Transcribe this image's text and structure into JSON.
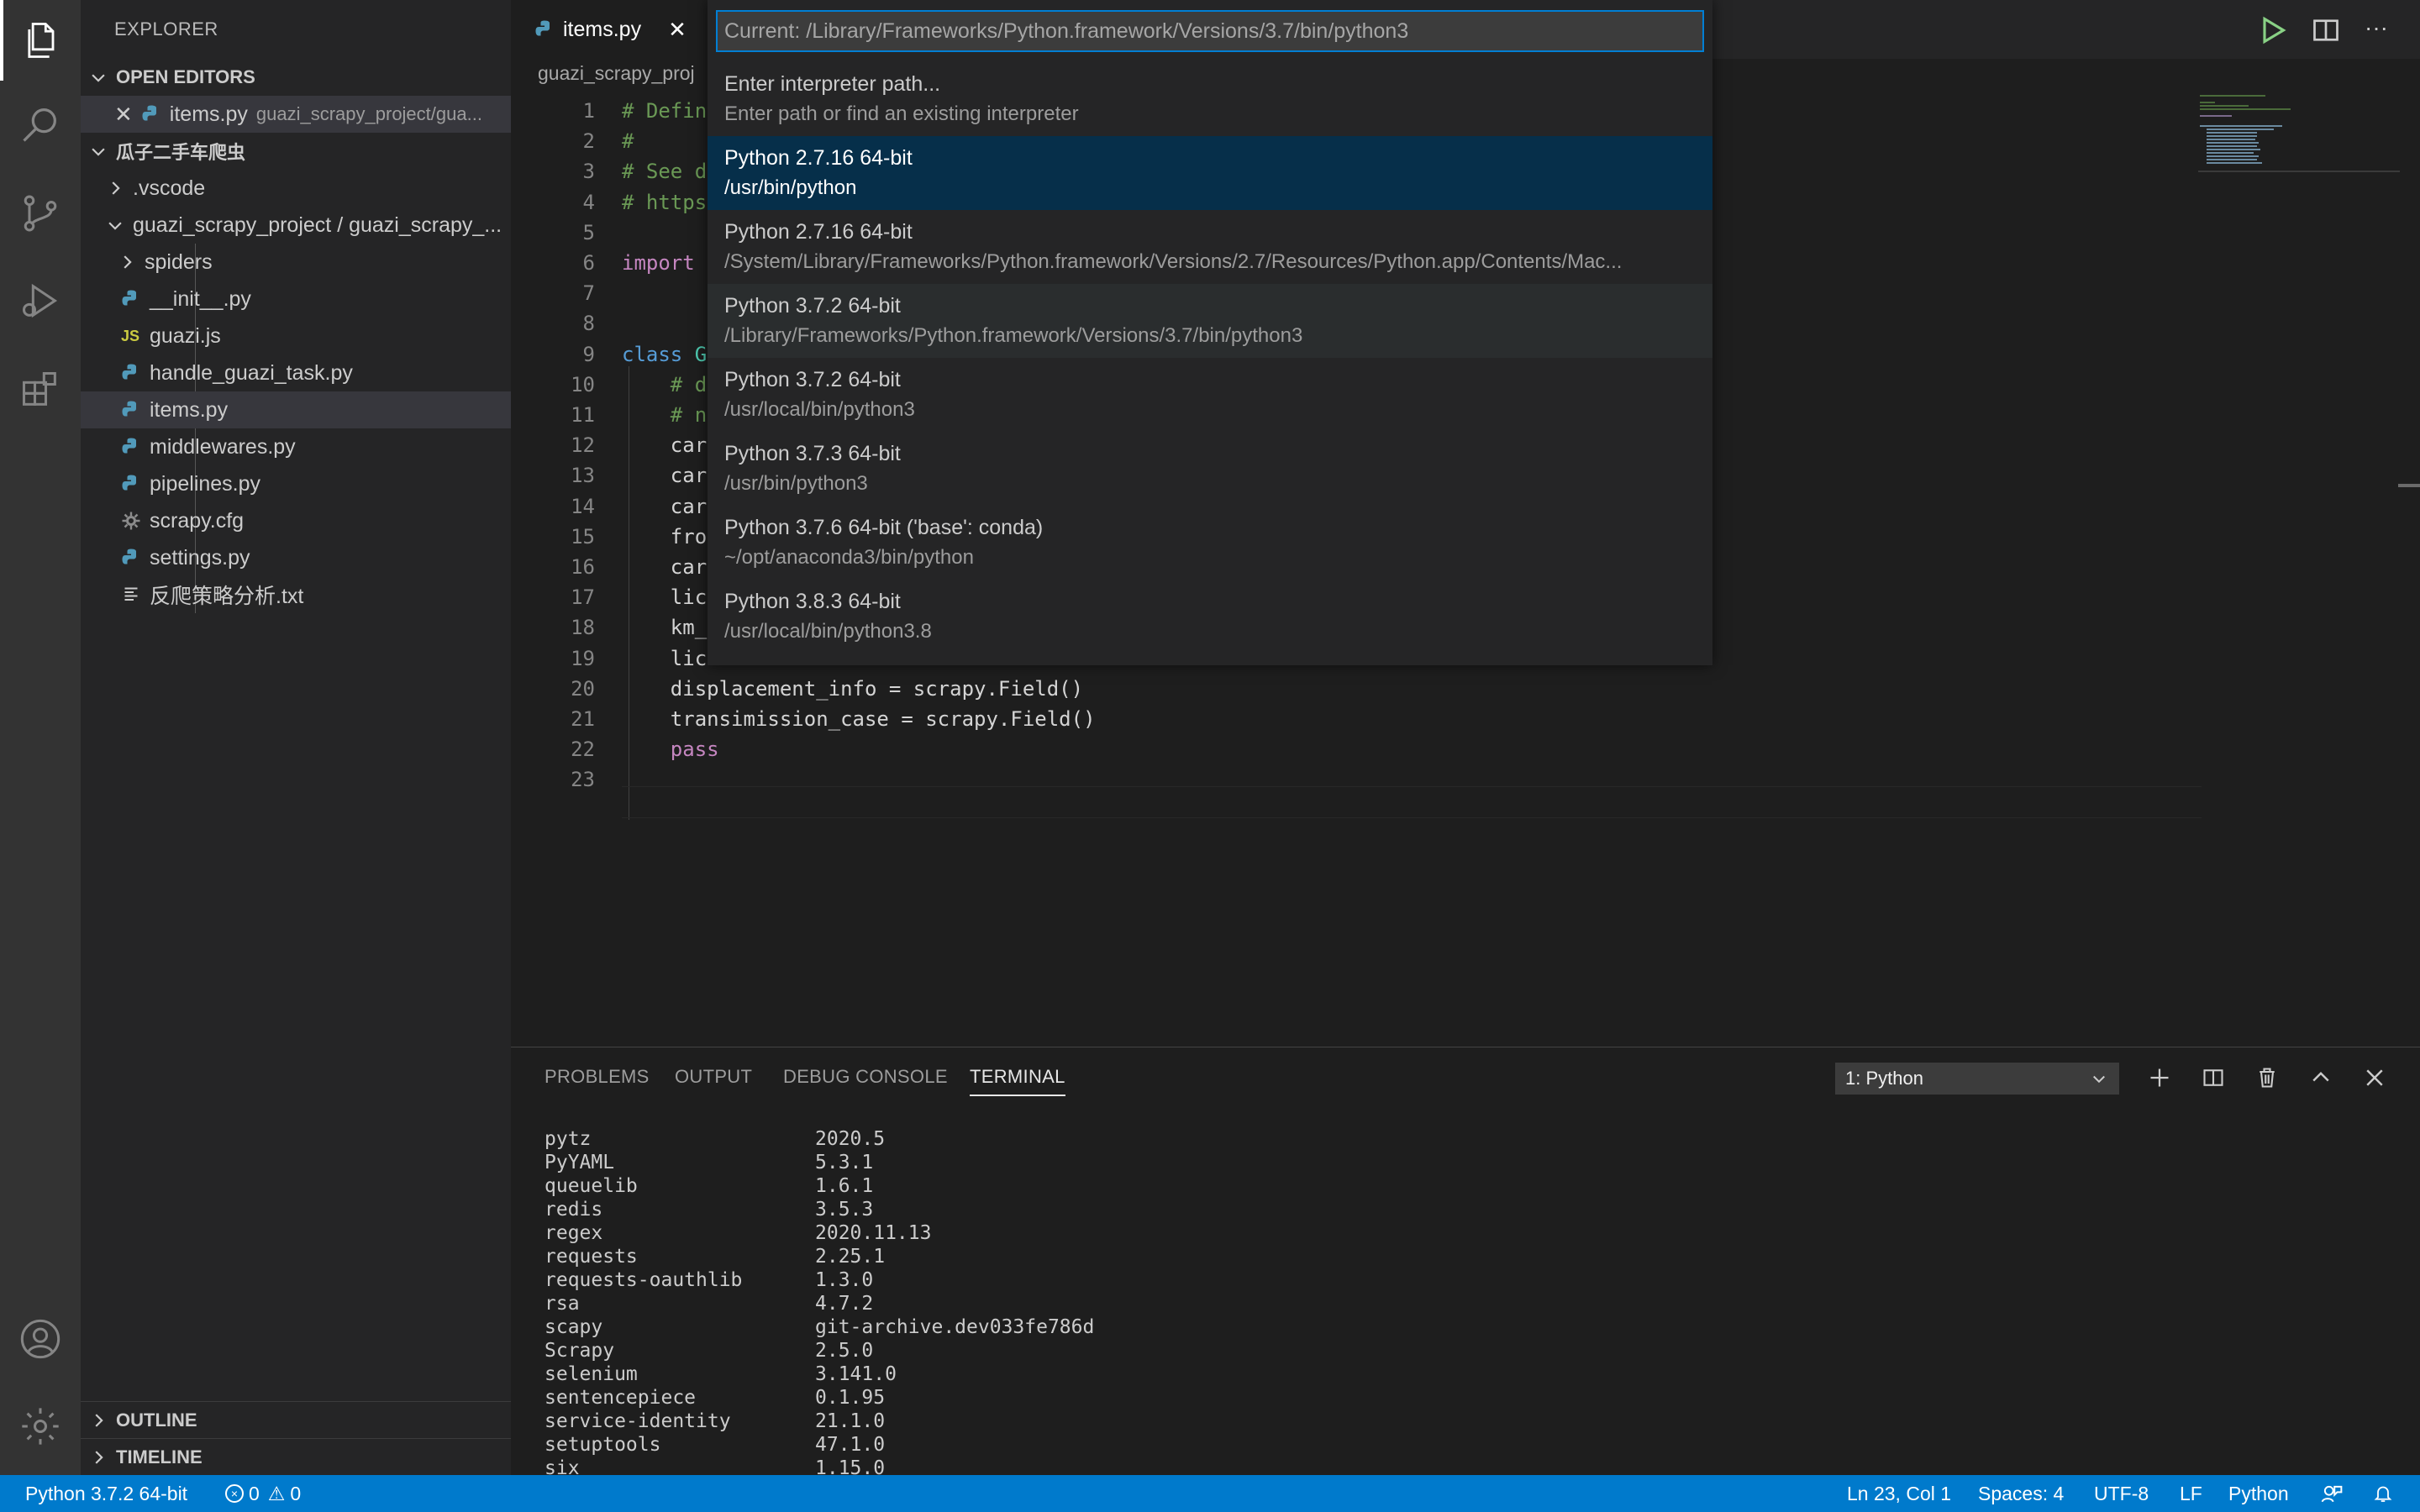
{
  "activity_bar": {
    "icons": [
      "files-icon",
      "search-icon",
      "source-control-icon",
      "run-debug-icon",
      "extensions-icon",
      "account-icon",
      "settings-gear-icon"
    ]
  },
  "sidebar": {
    "title": "EXPLORER",
    "open_editors_header": "OPEN EDITORS",
    "open_editor": {
      "name": "items.py",
      "description": "guazi_scrapy_project/gua..."
    },
    "workspace_header": "瓜子二手车爬虫",
    "tree": [
      {
        "label": ".vscode"
      },
      {
        "label": "guazi_scrapy_project / guazi_scrapy_..."
      },
      {
        "label": "spiders"
      },
      {
        "label": "__init__.py"
      },
      {
        "label": "guazi.js",
        "badge": "JS"
      },
      {
        "label": "handle_guazi_task.py"
      },
      {
        "label": "items.py"
      },
      {
        "label": "middlewares.py"
      },
      {
        "label": "pipelines.py"
      },
      {
        "label": "scrapy.cfg"
      },
      {
        "label": "settings.py"
      },
      {
        "label": "反爬策略分析.txt"
      }
    ],
    "outline_header": "OUTLINE",
    "timeline_header": "TIMELINE"
  },
  "tab": {
    "label": "items.py"
  },
  "breadcrumb": "guazi_scrapy_proj",
  "editor": {
    "lines": [
      {
        "n": "1",
        "html_parts": [
          {
            "cls": "cmt",
            "t": "# Defin"
          }
        ]
      },
      {
        "n": "2",
        "html_parts": [
          {
            "cls": "cmt",
            "t": "#"
          }
        ]
      },
      {
        "n": "3",
        "html_parts": [
          {
            "cls": "cmt",
            "t": "# See d"
          }
        ]
      },
      {
        "n": "4",
        "html_parts": [
          {
            "cls": "cmt",
            "t": "# https"
          }
        ]
      },
      {
        "n": "5",
        "html_parts": []
      },
      {
        "n": "6",
        "html_parts": [
          {
            "cls": "kw",
            "t": "import"
          }
        ]
      },
      {
        "n": "7",
        "html_parts": []
      },
      {
        "n": "8",
        "html_parts": []
      },
      {
        "n": "9",
        "html_parts": [
          {
            "cls": "kw2",
            "t": "class"
          },
          {
            "cls": "",
            "t": " "
          },
          {
            "cls": "cls",
            "t": "G"
          }
        ]
      },
      {
        "n": "10",
        "html_parts": [
          {
            "cls": "",
            "t": "    "
          },
          {
            "cls": "cmt",
            "t": "# d"
          }
        ]
      },
      {
        "n": "11",
        "html_parts": [
          {
            "cls": "",
            "t": "    "
          },
          {
            "cls": "cmt",
            "t": "# n"
          }
        ]
      },
      {
        "n": "12",
        "html_parts": [
          {
            "cls": "",
            "t": "    car"
          }
        ]
      },
      {
        "n": "13",
        "html_parts": [
          {
            "cls": "",
            "t": "    car"
          }
        ]
      },
      {
        "n": "14",
        "html_parts": [
          {
            "cls": "",
            "t": "    car"
          }
        ]
      },
      {
        "n": "15",
        "html_parts": [
          {
            "cls": "",
            "t": "    fro"
          }
        ]
      },
      {
        "n": "16",
        "html_parts": [
          {
            "cls": "",
            "t": "    car"
          }
        ]
      },
      {
        "n": "17",
        "html_parts": [
          {
            "cls": "",
            "t": "    lic"
          }
        ]
      },
      {
        "n": "18",
        "html_parts": [
          {
            "cls": "",
            "t": "    km_"
          }
        ]
      },
      {
        "n": "19",
        "html_parts": [
          {
            "cls": "",
            "t": "    lic"
          }
        ]
      },
      {
        "n": "20",
        "html_parts": [
          {
            "cls": "",
            "t": "    displacement_info = scrapy.Field()"
          }
        ]
      },
      {
        "n": "21",
        "html_parts": [
          {
            "cls": "",
            "t": "    transimission_case = scrapy.Field()"
          }
        ]
      },
      {
        "n": "22",
        "html_parts": [
          {
            "cls": "",
            "t": "    "
          },
          {
            "cls": "kw",
            "t": "pass"
          }
        ]
      },
      {
        "n": "23",
        "html_parts": []
      }
    ]
  },
  "quickpick": {
    "placeholder": "Current: /Library/Frameworks/Python.framework/Versions/3.7/bin/python3",
    "items": [
      {
        "label": "Enter interpreter path...",
        "detail": "Enter path or find an existing interpreter"
      },
      {
        "label": "Python 2.7.16 64-bit",
        "detail": "/usr/bin/python"
      },
      {
        "label": "Python 2.7.16 64-bit",
        "detail": "/System/Library/Frameworks/Python.framework/Versions/2.7/Resources/Python.app/Contents/Mac..."
      },
      {
        "label": "Python 3.7.2 64-bit",
        "detail": "/Library/Frameworks/Python.framework/Versions/3.7/bin/python3"
      },
      {
        "label": "Python 3.7.2 64-bit",
        "detail": "/usr/local/bin/python3"
      },
      {
        "label": "Python 3.7.3 64-bit",
        "detail": "/usr/bin/python3"
      },
      {
        "label": "Python 3.7.6 64-bit ('base': conda)",
        "detail": "~/opt/anaconda3/bin/python"
      },
      {
        "label": "Python 3.8.3 64-bit",
        "detail": "/usr/local/bin/python3.8"
      }
    ]
  },
  "panel": {
    "tabs": [
      "PROBLEMS",
      "OUTPUT",
      "DEBUG CONSOLE",
      "TERMINAL"
    ],
    "active_tab": "TERMINAL",
    "terminal_select": "1: Python",
    "terminal_rows": [
      [
        "pytz",
        "2020.5"
      ],
      [
        "PyYAML",
        "5.3.1"
      ],
      [
        "queuelib",
        "1.6.1"
      ],
      [
        "redis",
        "3.5.3"
      ],
      [
        "regex",
        "2020.11.13"
      ],
      [
        "requests",
        "2.25.1"
      ],
      [
        "requests-oauthlib",
        "1.3.0"
      ],
      [
        "rsa",
        "4.7.2"
      ],
      [
        "scapy",
        "git-archive.dev033fe786d"
      ],
      [
        "Scrapy",
        "2.5.0"
      ],
      [
        "selenium",
        "3.141.0"
      ],
      [
        "sentencepiece",
        "0.1.95"
      ],
      [
        "service-identity",
        "21.1.0"
      ],
      [
        "setuptools",
        "47.1.0"
      ],
      [
        "six",
        "1.15.0"
      ]
    ]
  },
  "status_bar": {
    "interpreter": "Python 3.7.2 64-bit",
    "errors": "0",
    "warnings": "0",
    "position": "Ln 23, Col 1",
    "spaces": "Spaces: 4",
    "encoding": "UTF-8",
    "eol": "LF",
    "language": "Python"
  },
  "colors": {
    "accent": "#007acc",
    "selection": "#062f4a",
    "activity_bar": "#333333",
    "sidebar": "#252526",
    "editor": "#1e1e1e"
  }
}
